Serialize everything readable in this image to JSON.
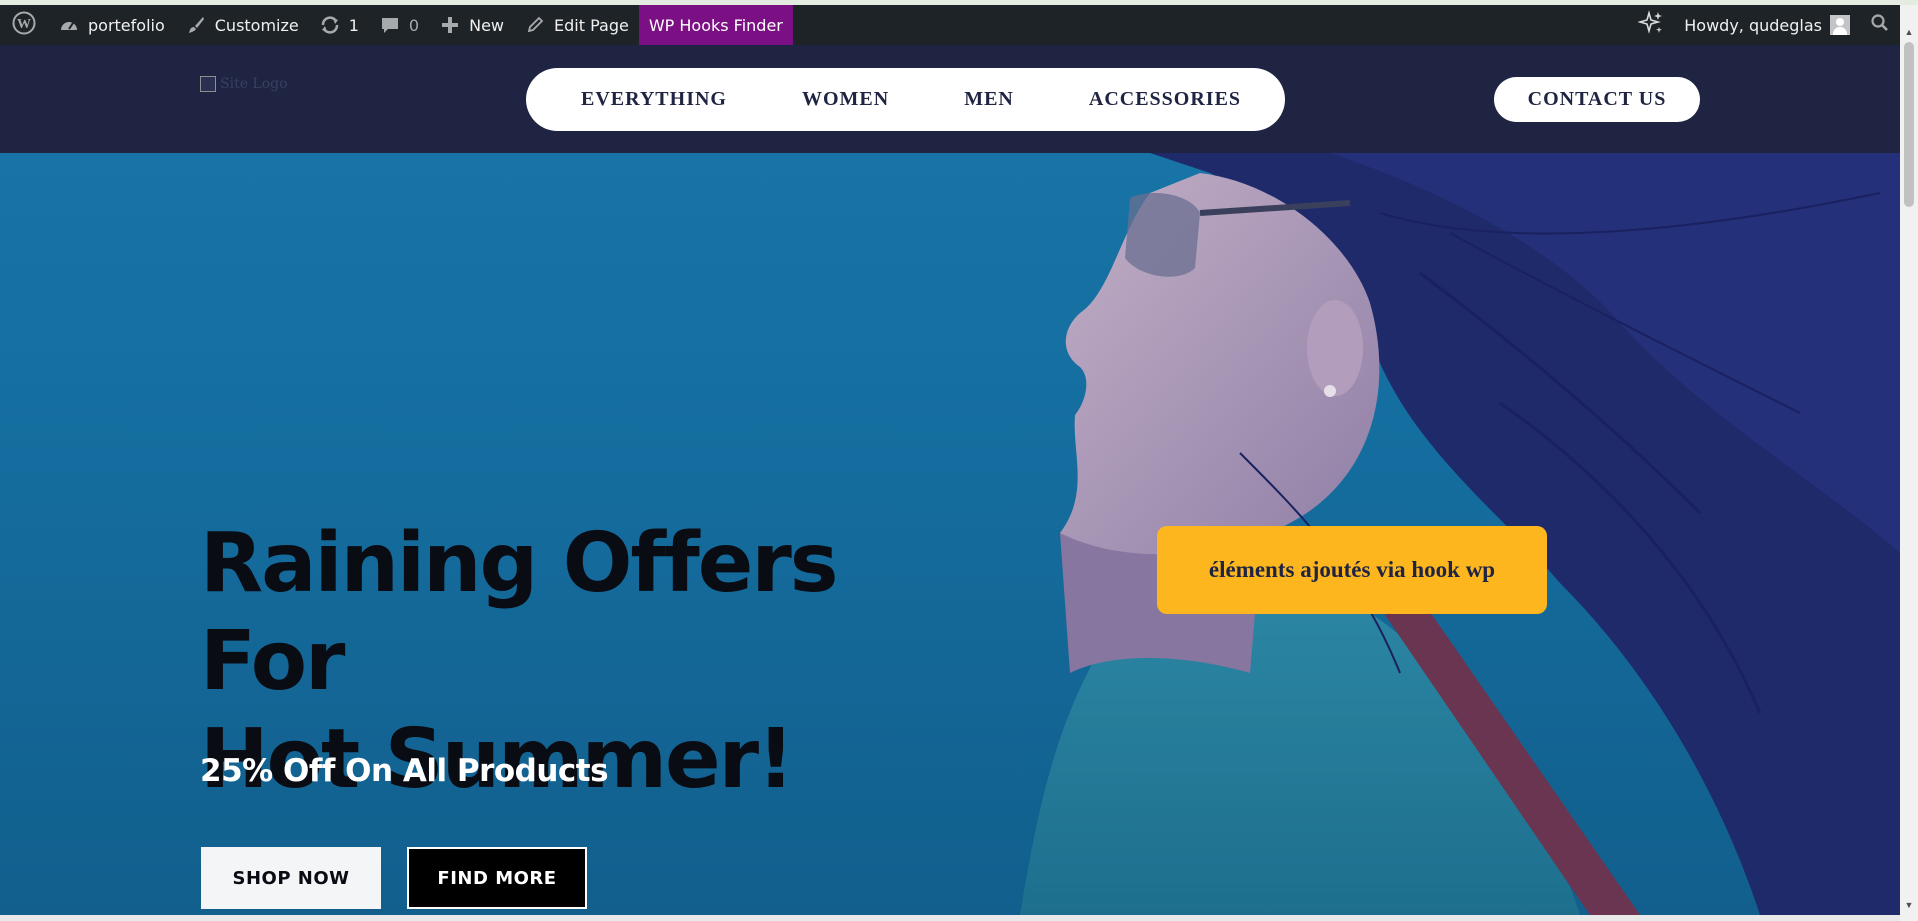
{
  "adminbar": {
    "wp_logo_icon": "wordpress-icon",
    "site_name": "portefolio",
    "customize": "Customize",
    "updates_count": "1",
    "comments_count": "0",
    "new": "New",
    "edit_page": "Edit Page",
    "hooks_finder": "WP Hooks Finder",
    "howdy": "Howdy, qudeglas"
  },
  "header": {
    "logo_alt": "Site Logo",
    "nav": [
      "EVERYTHING",
      "WOMEN",
      "MEN",
      "ACCESSORIES"
    ],
    "contact": "CONTACT US"
  },
  "hero": {
    "title_line1": "Raining Offers For",
    "title_line2": "Hot Summer!",
    "subtitle": "25% Off On All Products",
    "shop_now": "SHOP NOW",
    "find_more": "FIND MORE",
    "hook_box": "éléments ajoutés via hook wp"
  },
  "colors": {
    "admin_bar": "#1d2327",
    "hooks_finder_bg": "#7b1084",
    "header_bg": "#1e2442",
    "hero_bg": "#1874a6",
    "hook_box_bg": "#fdb61e"
  }
}
